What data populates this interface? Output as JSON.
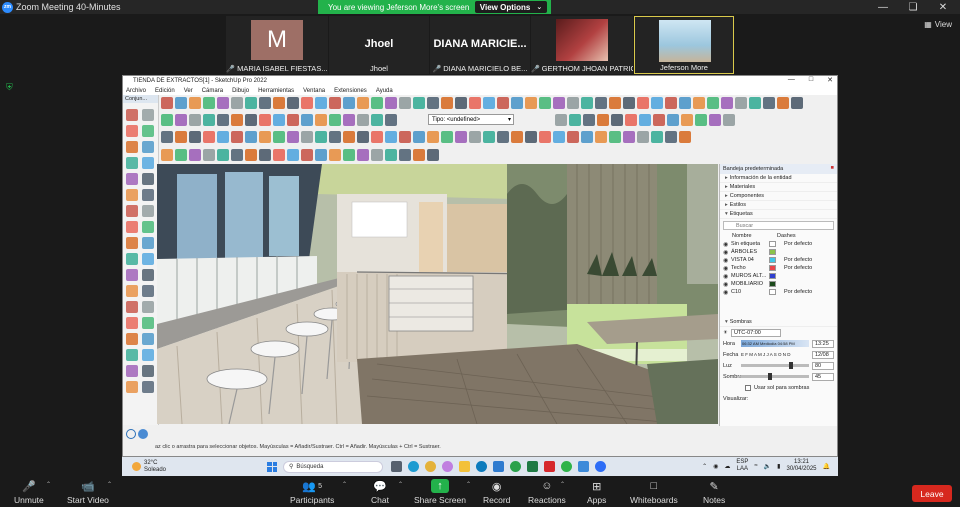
{
  "zoom": {
    "window_title": "Zoom Meeting 40-Minutes",
    "logo_text": "zm",
    "banner_text": "You are viewing Jeferson More's screen",
    "view_options_label": "View Options",
    "view_button_label": "View"
  },
  "participants": [
    {
      "name": "MARIA ISABEL FIESTAS...",
      "muted": true,
      "initial": "M"
    },
    {
      "name": "Jhoel",
      "display": "Jhoel",
      "muted": false
    },
    {
      "name": "DIANA MARICIELO BE...",
      "display": "DIANA  MARICIE...",
      "muted": true
    },
    {
      "name": "GERTHOM JHOAN PATRIC...",
      "muted": true
    },
    {
      "name": "Jeferson More",
      "muted": false
    }
  ],
  "sketchup": {
    "title": "TIENDA DE EXTRACTOS[1] - SketchUp Pro 2022",
    "menu": [
      "Archivo",
      "Edición",
      "Ver",
      "Cámara",
      "Dibujo",
      "Herramientas",
      "Ventana",
      "Extensiones",
      "Ayuda"
    ],
    "tipo_label": "Tipo: <undefined>",
    "left_panel_title": "Conjun...",
    "status_text": "az clic o arrastra para seleccionar objetos. Mayúsculas = Añadir/Sustraer. Ctrl = Añadir. Mayúsculas + Ctrl = Sustraer."
  },
  "tray": {
    "title": "Bandeja predeterminada",
    "sections": [
      "Información de la entidad",
      "Materiales",
      "Componentes",
      "Estilos",
      "Etiquetas"
    ],
    "search_placeholder": "Buscar",
    "tag_headers": {
      "name": "Nombre",
      "dashes": "Dashes"
    },
    "tags": [
      {
        "name": "Sin etiqueta",
        "color": "#ffffff",
        "dash": "Por defecto"
      },
      {
        "name": "ÁRBOLES",
        "color": "#8bc34a",
        "dash": ""
      },
      {
        "name": "VISTA 04",
        "color": "#3ec7e8",
        "dash": "Por defecto"
      },
      {
        "name": "Techo",
        "color": "#e9454a",
        "dash": "Por defecto"
      },
      {
        "name": "MUROS ALT...",
        "color": "#2f3fcf",
        "dash": ""
      },
      {
        "name": "MOBILIARIO",
        "color": "#1c4a1c",
        "dash": ""
      },
      {
        "name": "C10",
        "color": "#ffffff",
        "dash": "Por defecto"
      }
    ],
    "shadows": {
      "title": "Sombras",
      "timezone": "UTC-07:00",
      "hora_label": "Hora",
      "hora_times": "06:32 AM Mediodía 04:58 PM",
      "hora_value": "13:25",
      "fecha_label": "Fecha",
      "fecha_months": "E F M A M J J A S O N D",
      "fecha_value": "12/08",
      "luz_label": "Luz",
      "luz_value": "80",
      "sombra_label": "Sombra",
      "sombra_value": "45",
      "checkbox_label": "Usar sol para sombras",
      "visualizar_label": "Visualizar:"
    }
  },
  "taskbar": {
    "temperature": "32°C",
    "weather": "Soleado",
    "search_label": "Búsqueda",
    "lang_top": "ESP",
    "lang_bottom": "LAA",
    "time": "13:21",
    "date": "30/04/2025"
  },
  "controls": {
    "participants_count": "5",
    "unmute": "Unmute",
    "start_video": "Start Video",
    "participants": "Participants",
    "chat": "Chat",
    "share": "Share Screen",
    "record": "Record",
    "reactions": "Reactions",
    "apps": "Apps",
    "whiteboards": "Whiteboards",
    "notes": "Notes",
    "leave": "Leave"
  }
}
